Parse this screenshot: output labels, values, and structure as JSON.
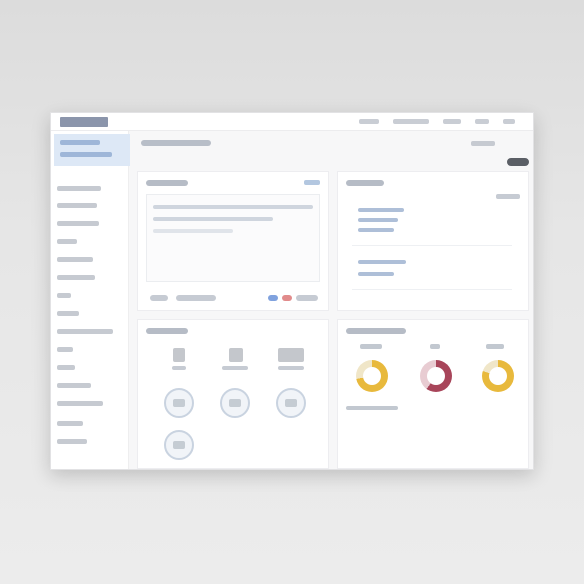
{
  "app": {
    "brand": ""
  },
  "topnav": [
    "",
    "",
    "",
    "",
    ""
  ],
  "sidebar": {
    "items": [
      "",
      "",
      "",
      "",
      "",
      "",
      "",
      "",
      "",
      "",
      "",
      "",
      "",
      "",
      "",
      "",
      ""
    ]
  },
  "main": {
    "page_title": "",
    "top_right": "",
    "top_button": ""
  },
  "composer": {
    "title": "",
    "link": "",
    "lines": [
      "",
      "",
      "",
      "",
      ""
    ]
  },
  "activity": {
    "title": "",
    "link": "",
    "rows": [
      "",
      "",
      "",
      "",
      ""
    ]
  },
  "shortcuts": {
    "title": "",
    "tiles": [
      "",
      "",
      "",
      "",
      "",
      "",
      ""
    ]
  },
  "stats": {
    "title": "",
    "donuts": [
      "",
      "",
      ""
    ],
    "footer": ""
  },
  "colors": {
    "accent": "#4a7bd0",
    "gold": "#e8b93c",
    "crimson": "#a8455a",
    "sidebar_active": "#dde8f6"
  }
}
